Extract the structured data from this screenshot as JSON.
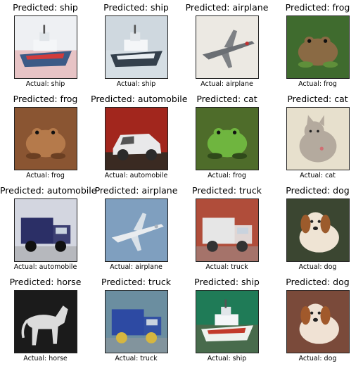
{
  "predicted_prefix": "Predicted: ",
  "actual_prefix": "Actual: ",
  "samples": [
    {
      "predicted": "ship",
      "actual": "ship",
      "subject": "ship",
      "bg": "#eef0f3",
      "fg": "#3c5a86",
      "accent": "#d23b3b"
    },
    {
      "predicted": "ship",
      "actual": "ship",
      "subject": "ship",
      "bg": "#cfd8df",
      "fg": "#34404c",
      "accent": "#e8eef2"
    },
    {
      "predicted": "airplane",
      "actual": "airplane",
      "subject": "airplane",
      "bg": "#ece9e3",
      "fg": "#6b6f74",
      "accent": "#c03030"
    },
    {
      "predicted": "frog",
      "actual": "frog",
      "subject": "frog",
      "bg": "#3f6b2e",
      "fg": "#8a6a44",
      "accent": "#5f8f3a"
    },
    {
      "predicted": "frog",
      "actual": "frog",
      "subject": "frog",
      "bg": "#8a5532",
      "fg": "#b57a4b",
      "accent": "#6b3f22"
    },
    {
      "predicted": "automobile",
      "actual": "automobile",
      "subject": "car",
      "bg": "#a2261d",
      "fg": "#e9e9ea",
      "accent": "#2b2b2b"
    },
    {
      "predicted": "cat",
      "actual": "frog",
      "subject": "frog",
      "bg": "#4e6c2a",
      "fg": "#6fb53f",
      "accent": "#2f4a1a"
    },
    {
      "predicted": "cat",
      "actual": "cat",
      "subject": "cat",
      "bg": "#e7e0cd",
      "fg": "#b4aa9e",
      "accent": "#cf6f73"
    },
    {
      "predicted": "automobile",
      "actual": "automobile",
      "subject": "truck",
      "bg": "#d3d6e0",
      "fg": "#2b2f66",
      "accent": "#111"
    },
    {
      "predicted": "airplane",
      "actual": "airplane",
      "subject": "airplane",
      "bg": "#7f9fbf",
      "fg": "#e9ecef",
      "accent": "#aab3bd"
    },
    {
      "predicted": "truck",
      "actual": "truck",
      "subject": "truck",
      "bg": "#b04d3a",
      "fg": "#e6e6e6",
      "accent": "#333"
    },
    {
      "predicted": "dog",
      "actual": "dog",
      "subject": "dog",
      "bg": "#3b4631",
      "fg": "#efe4d4",
      "accent": "#9c5b2c"
    },
    {
      "predicted": "horse",
      "actual": "horse",
      "subject": "horse",
      "bg": "#1b1b1b",
      "fg": "#dcdcdc",
      "accent": "#555"
    },
    {
      "predicted": "truck",
      "actual": "truck",
      "subject": "truck",
      "bg": "#6b8ea0",
      "fg": "#2d4aa3",
      "accent": "#d6b640"
    },
    {
      "predicted": "ship",
      "actual": "ship",
      "subject": "ship",
      "bg": "#1f7b57",
      "fg": "#eef2ee",
      "accent": "#c23b2b"
    },
    {
      "predicted": "dog",
      "actual": "dog",
      "subject": "dog",
      "bg": "#7a4a3a",
      "fg": "#f0e2d4",
      "accent": "#a1592b"
    }
  ]
}
